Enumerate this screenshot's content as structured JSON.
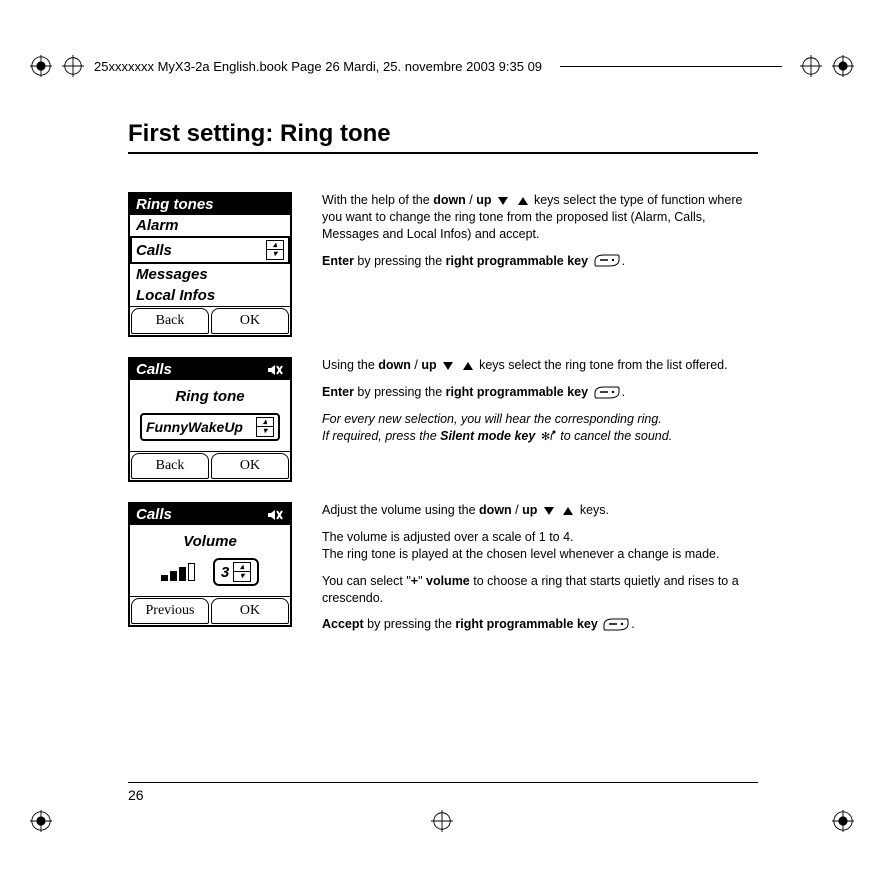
{
  "header": {
    "text": "25xxxxxxx MyX3-2a English.book  Page 26  Mardi, 25. novembre 2003  9:35 09"
  },
  "title": "First setting: Ring tone",
  "page_number": "26",
  "screens": {
    "s1": {
      "title": "Ring tones",
      "items": [
        "Alarm",
        "Calls",
        "Messages",
        "Local Infos"
      ],
      "soft_left": "Back",
      "soft_right": "OK"
    },
    "s2": {
      "title": "Calls",
      "label": "Ring tone",
      "value": "FunnyWakeUp",
      "soft_left": "Back",
      "soft_right": "OK"
    },
    "s3": {
      "title": "Calls",
      "label": "Volume",
      "value": "3",
      "soft_left": "Previous",
      "soft_right": "OK"
    }
  },
  "text": {
    "p1a": "With the help of the ",
    "p1b": "down",
    "p1c": " / ",
    "p1d": "up",
    "p1e": " keys select the type of function where you want to change the ring tone from the proposed list (Alarm, Calls, Messages and Local Infos) and accept.",
    "p2a": "Enter",
    "p2b": " by pressing the ",
    "p2c": "right programmable key",
    "p2d": ".",
    "p3a": "Using the ",
    "p3b": "down",
    "p3c": " / ",
    "p3d": "up",
    "p3e": " keys select the ring tone  from the list offered.",
    "p4a": "Enter",
    "p4b": " by pressing the ",
    "p4c": "right programmable key",
    "p4d": ".",
    "p5": "For every new selection, you will hear the corresponding ring.",
    "p6a": "If required, press the ",
    "p6b": "Silent mode key",
    "p6c": "  to cancel the sound.",
    "p7a": "Adjust the volume using the ",
    "p7b": "down",
    "p7c": " / ",
    "p7d": "up",
    "p7e": " keys.",
    "p8": "The volume is adjusted over a scale of 1 to 4.",
    "p9": "The ring tone is played at the chosen level whenever a change is made.",
    "p10a": "You can select \"",
    "p10b": "+",
    "p10c": "\" ",
    "p10d": "volume",
    "p10e": " to choose a ring that starts quietly and rises to a crescendo.",
    "p11a": "Accept",
    "p11b": " by pressing the ",
    "p11c": "right programmable key",
    "p11d": "."
  }
}
